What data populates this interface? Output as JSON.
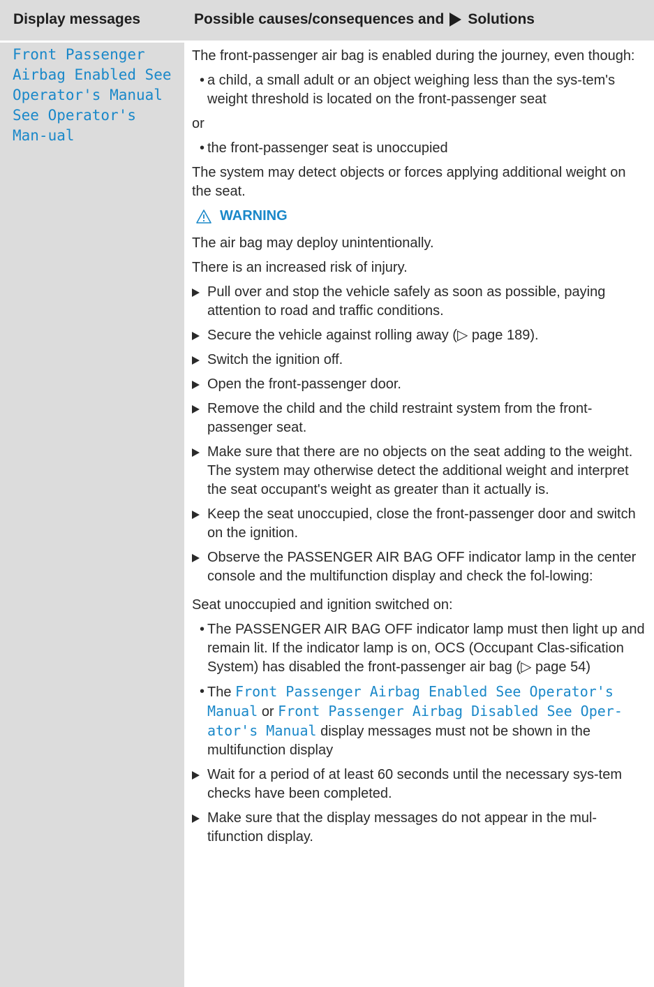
{
  "header": {
    "left": "Display messages",
    "right_before": "Possible causes/consequences and",
    "right_after": "Solutions"
  },
  "display_message": "Front Passenger Airbag Enabled See Operator's Manual See Operator's Man-ual",
  "intro": "The front-passenger air bag is enabled during the journey, even though:",
  "bullets": [
    "a child, a small adult or an object weighing less than the sys-tem's weight threshold is located on the front-passenger seat",
    "the front-passenger seat is unoccupied"
  ],
  "or_text": "or",
  "detect_text": "The system may detect objects or forces applying additional weight on the seat.",
  "warning": {
    "icon": "warning-triangle-icon",
    "label": "WARNING",
    "lines": [
      "The air bag may deploy unintentionally.",
      "There is an increased risk of injury."
    ]
  },
  "steps": [
    "Pull over and stop the vehicle safely as soon as possible, paying attention to road and traffic conditions.",
    "Secure the vehicle against rolling away (▷ page 189).",
    "Switch the ignition off.",
    "Open the front-passenger door.",
    "Remove the child and the child restraint system from the front-passenger seat.",
    "Make sure that there are no objects on the seat adding to the weight.",
    "Keep the seat unoccupied, close the front-passenger door and switch on the ignition.",
    "Observe the PASSENGER AIR BAG OFF indicator lamp in the center console and the multifunction display and check the fol-lowing:"
  ],
  "step6_note": "The system may otherwise detect the additional weight and interpret the seat occupant's weight as greater than it actually is.",
  "seat_unoccupied": "Seat unoccupied and ignition switched on:",
  "check_bullets": {
    "lamp": "The PASSENGER AIR BAG OFF indicator lamp must then light up and remain lit. If the indicator lamp is on, OCS (Occupant Clas-sification System) has disabled the front-passenger air bag (▷ page 54)",
    "msg_prefix": "The",
    "msg_enabled": "Front Passenger Airbag Enabled See Operator's Manual",
    "msg_or": "or",
    "msg_disabled": "Front Passenger Airbag Disabled See Oper-ator's Manual",
    "msg_suffix": "display messages must not be shown in the multifunction display"
  },
  "final_steps": [
    "Wait for a period of at least 60 seconds until the necessary sys-tem checks have been completed.",
    "Make sure that the display messages do not appear in the mul-tifunction display."
  ],
  "colors": {
    "accent": "#1a88c9",
    "header_bg": "#dcdcdc"
  }
}
